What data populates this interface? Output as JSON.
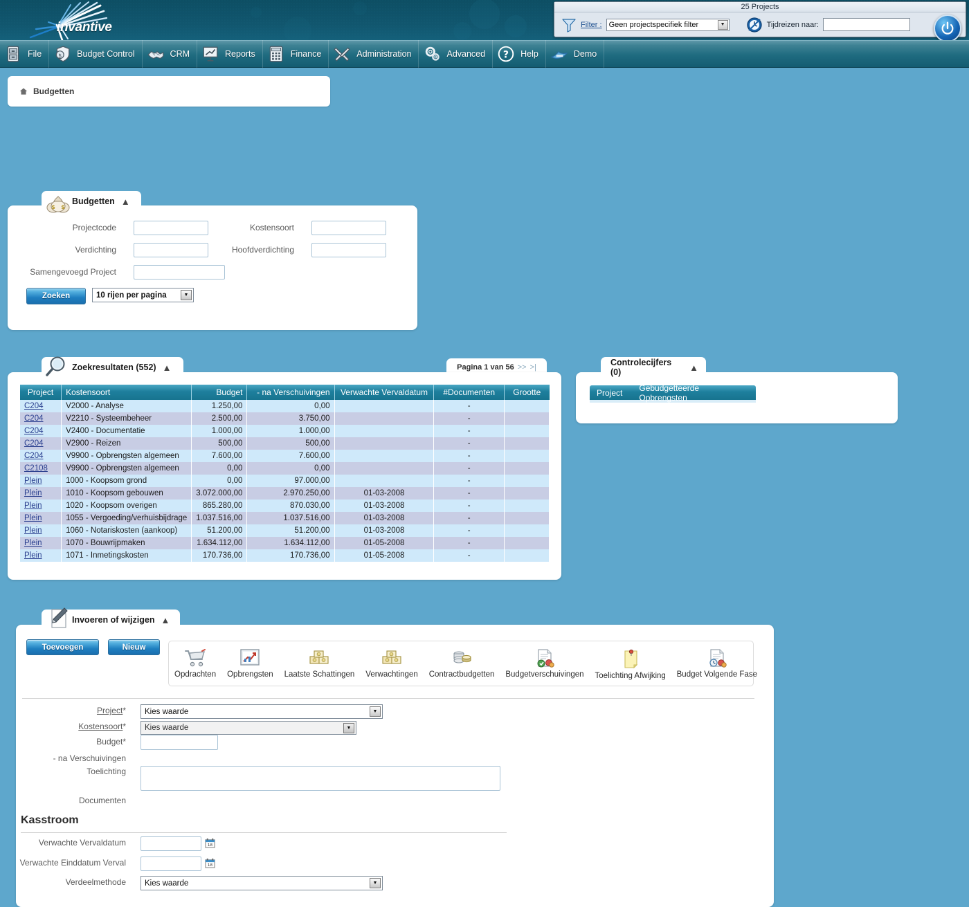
{
  "app": {
    "brand": "invantive",
    "logo_icon": "starburst-logo"
  },
  "topbar": {
    "title": "25 Projects",
    "filter_icon": "funnel-icon",
    "filter_label": "Filter :",
    "filter_value": "Geen projectspecifiek filter",
    "timetravel_icon": "clock-icon",
    "timetravel_label": "Tijdreizen naar:",
    "timetravel_value": "",
    "power_icon": "power-icon"
  },
  "menu": [
    {
      "label": "File",
      "icon": "cabinet-icon"
    },
    {
      "label": "Budget Control",
      "icon": "money-shield-icon"
    },
    {
      "label": "CRM",
      "icon": "handshake-icon"
    },
    {
      "label": "Reports",
      "icon": "presentation-chart-icon"
    },
    {
      "label": "Finance",
      "icon": "calculator-icon"
    },
    {
      "label": "Administration",
      "icon": "tools-icon"
    },
    {
      "label": "Advanced",
      "icon": "gears-icon"
    },
    {
      "label": "Help",
      "icon": "question-mark-icon"
    },
    {
      "label": "Demo",
      "icon": "bird-icon"
    }
  ],
  "breadcrumb": {
    "home_icon": "home-icon",
    "text": "Budgetten"
  },
  "search_panel": {
    "title": "Budgetten",
    "icon": "money-bags-icon",
    "collapse_icon": "chevron-up-icon",
    "fields": {
      "projectcode": {
        "label": "Projectcode",
        "value": ""
      },
      "kostensoort": {
        "label": "Kostensoort",
        "value": ""
      },
      "verdichting": {
        "label": "Verdichting",
        "value": ""
      },
      "hoofdverdichting": {
        "label": "Hoofdverdichting",
        "value": ""
      },
      "samengevoegd_project": {
        "label": "Samengevoegd Project",
        "value": ""
      }
    },
    "search_button": "Zoeken",
    "rows_per_page": "10 rijen per pagina"
  },
  "results_panel": {
    "title": "Zoekresultaten (552)",
    "icon": "magnifier-icon",
    "collapse_icon": "chevron-up-icon",
    "pager": {
      "text": "Pagina 1 van 56",
      "next": ">>",
      "last": ">|"
    },
    "columns": [
      "Project",
      "Kostensoort",
      "Budget",
      "- na Verschuivingen",
      "Verwachte Vervaldatum",
      "#Documenten",
      "Grootte"
    ],
    "rows": [
      {
        "project": "C204",
        "kostensoort": "V2000 - Analyse",
        "budget": "1.250,00",
        "na_verschuivingen": "0,00",
        "vervaldatum": "",
        "documenten": "-",
        "grootte": ""
      },
      {
        "project": "C204",
        "kostensoort": "V2210 - Systeembeheer",
        "budget": "2.500,00",
        "na_verschuivingen": "3.750,00",
        "vervaldatum": "",
        "documenten": "-",
        "grootte": ""
      },
      {
        "project": "C204",
        "kostensoort": "V2400 - Documentatie",
        "budget": "1.000,00",
        "na_verschuivingen": "1.000,00",
        "vervaldatum": "",
        "documenten": "-",
        "grootte": ""
      },
      {
        "project": "C204",
        "kostensoort": "V2900 - Reizen",
        "budget": "500,00",
        "na_verschuivingen": "500,00",
        "vervaldatum": "",
        "documenten": "-",
        "grootte": ""
      },
      {
        "project": "C204",
        "kostensoort": "V9900 - Opbrengsten algemeen",
        "budget": "7.600,00",
        "na_verschuivingen": "7.600,00",
        "vervaldatum": "",
        "documenten": "-",
        "grootte": ""
      },
      {
        "project": "C2108",
        "kostensoort": "V9900 - Opbrengsten algemeen",
        "budget": "0,00",
        "na_verschuivingen": "0,00",
        "vervaldatum": "",
        "documenten": "-",
        "grootte": ""
      },
      {
        "project": "Plein",
        "kostensoort": "1000 - Koopsom grond",
        "budget": "0,00",
        "na_verschuivingen": "97.000,00",
        "vervaldatum": "",
        "documenten": "-",
        "grootte": ""
      },
      {
        "project": "Plein",
        "kostensoort": "1010 - Koopsom gebouwen",
        "budget": "3.072.000,00",
        "na_verschuivingen": "2.970.250,00",
        "vervaldatum": "01-03-2008",
        "documenten": "-",
        "grootte": ""
      },
      {
        "project": "Plein",
        "kostensoort": "1020 - Koopsom overigen",
        "budget": "865.280,00",
        "na_verschuivingen": "870.030,00",
        "vervaldatum": "01-03-2008",
        "documenten": "-",
        "grootte": ""
      },
      {
        "project": "Plein",
        "kostensoort": "1055 - Vergoeding/verhuisbijdrage",
        "budget": "1.037.516,00",
        "na_verschuivingen": "1.037.516,00",
        "vervaldatum": "01-03-2008",
        "documenten": "-",
        "grootte": ""
      },
      {
        "project": "Plein",
        "kostensoort": "1060 - Notariskosten (aankoop)",
        "budget": "51.200,00",
        "na_verschuivingen": "51.200,00",
        "vervaldatum": "01-03-2008",
        "documenten": "-",
        "grootte": ""
      },
      {
        "project": "Plein",
        "kostensoort": "1070 - Bouwrijpmaken",
        "budget": "1.634.112,00",
        "na_verschuivingen": "1.634.112,00",
        "vervaldatum": "01-05-2008",
        "documenten": "-",
        "grootte": ""
      },
      {
        "project": "Plein",
        "kostensoort": "1071 - Inmetingskosten",
        "budget": "170.736,00",
        "na_verschuivingen": "170.736,00",
        "vervaldatum": "01-05-2008",
        "documenten": "-",
        "grootte": ""
      }
    ]
  },
  "controlecijfers_panel": {
    "title": "Controlecijfers (0)",
    "collapse_icon": "chevron-up-icon",
    "columns": [
      "Project",
      "Gebudgetteerde Opbrengsten"
    ],
    "rows": []
  },
  "edit_panel": {
    "title": "Invoeren of wijzigen",
    "icon": "pencil-document-icon",
    "collapse_icon": "chevron-up-icon",
    "buttons": {
      "add": "Toevoegen",
      "new": "Nieuw"
    },
    "toolbar": [
      {
        "label": "Opdrachten",
        "icon": "shopping-cart-icon"
      },
      {
        "label": "Opbrengsten",
        "icon": "chart-growth-icon"
      },
      {
        "label": "Laatste Schattingen",
        "icon": "money-stack-icon"
      },
      {
        "label": "Verwachtingen",
        "icon": "money-stack-icon"
      },
      {
        "label": "Contractbudgetten",
        "icon": "coins-icon"
      },
      {
        "label": "Budgetverschuivingen",
        "icon": "document-arrows-icon"
      },
      {
        "label": "Toelichting Afwijking",
        "icon": "sticky-note-icon"
      },
      {
        "label": "Budget Volgende Fase",
        "icon": "document-clock-icon"
      }
    ],
    "form": {
      "project": {
        "label": "Project",
        "required": "*",
        "value": "Kies waarde"
      },
      "kostensoort": {
        "label": "Kostensoort",
        "required": "*",
        "value": "Kies waarde"
      },
      "budget": {
        "label": "Budget",
        "required": "*",
        "value": ""
      },
      "na_verschuivingen": {
        "label": "- na Verschuivingen",
        "required": "",
        "value": ""
      },
      "toelichting": {
        "label": "Toelichting",
        "required": "",
        "value": ""
      },
      "documenten": {
        "label": "Documenten",
        "required": "",
        "value": ""
      }
    },
    "kasstroom": {
      "title": "Kasstroom",
      "verwachte_vervaldatum": {
        "label": "Verwachte Vervaldatum",
        "value": "",
        "icon": "calendar-icon"
      },
      "verwachte_einddatum_verval": {
        "label": "Verwachte Einddatum Verval",
        "value": "",
        "icon": "calendar-icon"
      },
      "verdeelmethode": {
        "label": "Verdeelmethode",
        "value": "Kies waarde"
      }
    }
  },
  "colors": {
    "page_bg": "#5ea7cc",
    "banner_dark": "#0d4e63",
    "menu_teal": "#1f6b80",
    "grid_header": "#1e7f9d",
    "row_odd": "#cfe9fa",
    "row_even": "#c8cde4",
    "link": "#2a3f8f"
  }
}
